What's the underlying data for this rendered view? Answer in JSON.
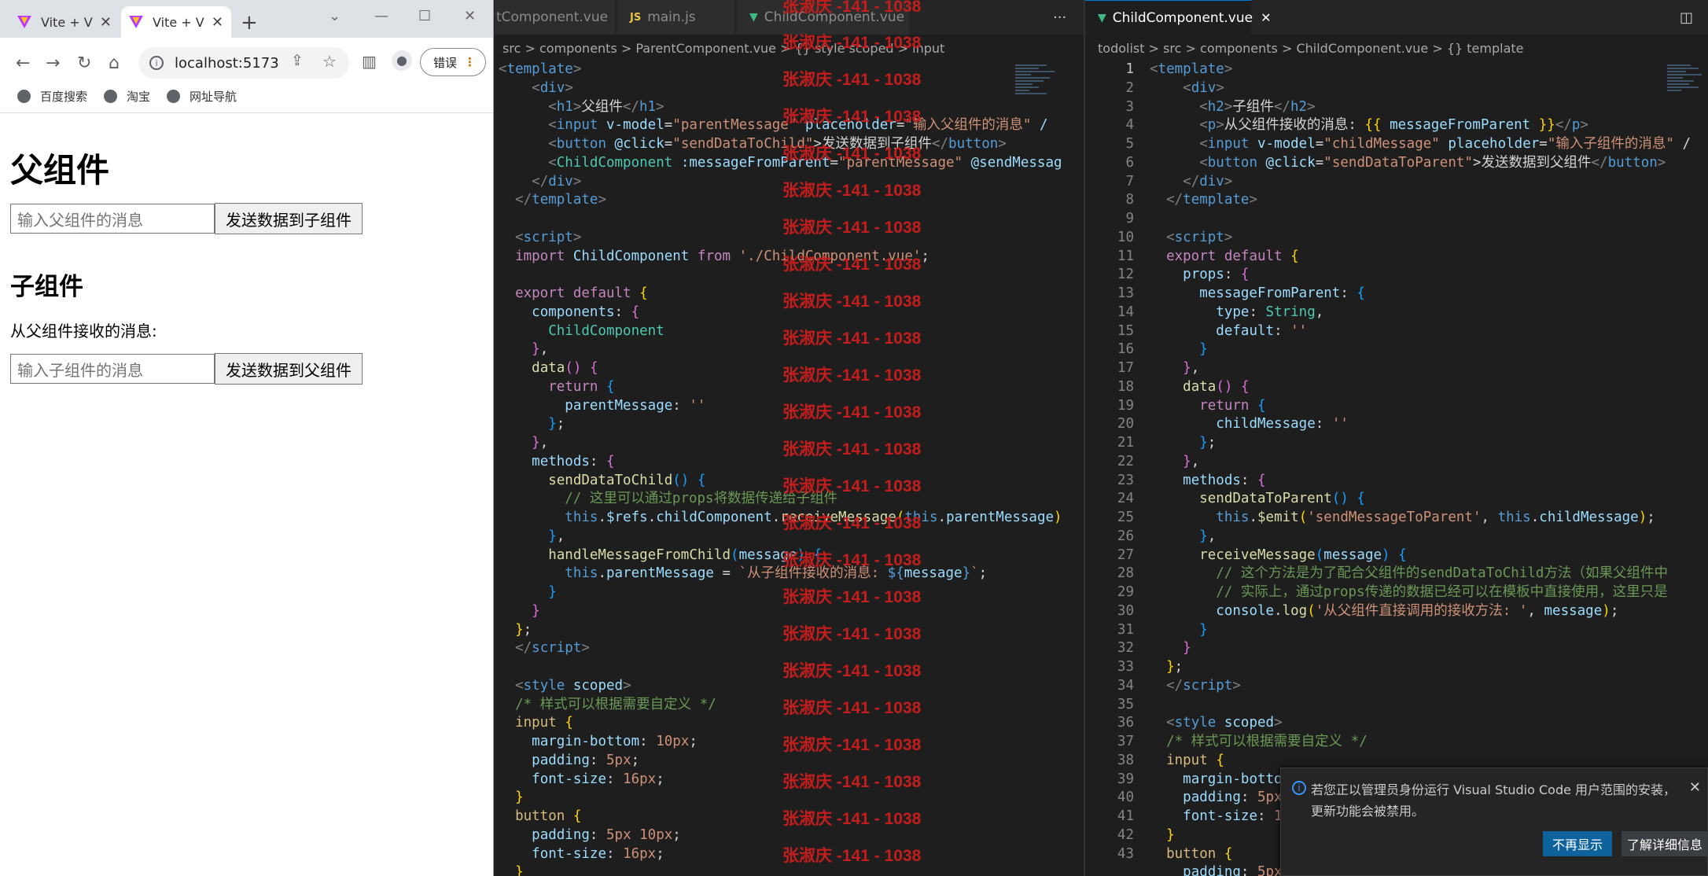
{
  "browser": {
    "tabs": [
      {
        "title": "Vite + V"
      },
      {
        "title": "Vite + V"
      }
    ],
    "url": "localhost:5173",
    "error_button": "错误",
    "bookmarks": [
      "百度搜索",
      "淘宝",
      "网址导航"
    ],
    "page": {
      "parent_heading": "父组件",
      "parent_input_placeholder": "输入父组件的消息",
      "parent_button": "发送数据到子组件",
      "child_heading": "子组件",
      "child_received": "从父组件接收的消息:",
      "child_input_placeholder": "输入子组件的消息",
      "child_button": "发送数据到父组件"
    }
  },
  "editor_left": {
    "tabs": [
      "tComponent.vue",
      "main.js",
      "ChildComponent.vue"
    ],
    "breadcrumb": "src > components > ParentComponent.vue > {} style scoped > input"
  },
  "editor_right": {
    "tabs": [
      "ChildComponent.vue"
    ],
    "breadcrumb": "todolist > src > components > ChildComponent.vue > {} template"
  },
  "watermark": "张淑庆 -141 - 1038",
  "notification": {
    "message": "若您正以管理员身份运行 Visual Studio Code 用户范围的安装，更新功能会被禁用。",
    "primary": "不再显示",
    "secondary": "了解详细信息"
  },
  "colors": {
    "accent": "#007acc",
    "vue": "#41b883"
  }
}
